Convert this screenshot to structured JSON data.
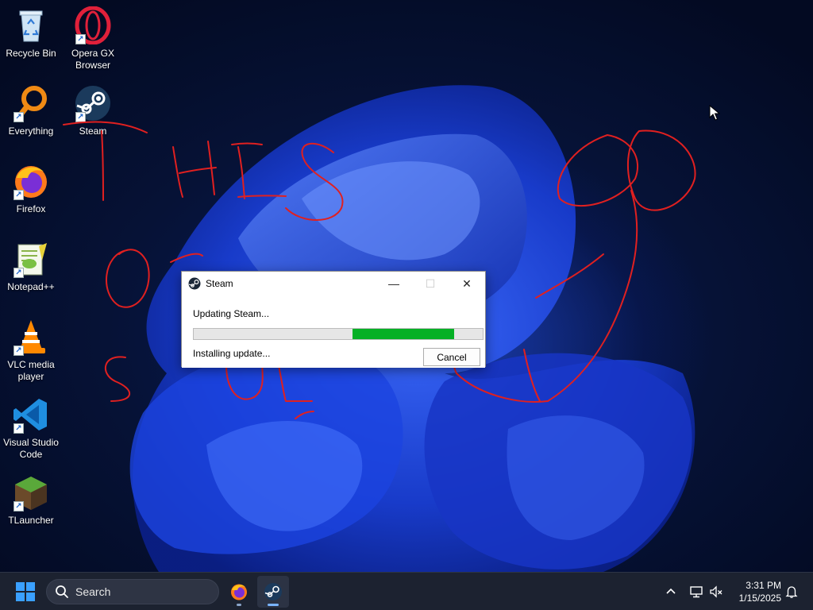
{
  "desktop": {
    "icons": [
      {
        "label": "Recycle Bin",
        "icon": "recycle-bin-icon"
      },
      {
        "label": "Opera GX Browser",
        "icon": "opera-gx-icon"
      },
      {
        "label": "Everything",
        "icon": "everything-search-icon"
      },
      {
        "label": "Steam",
        "icon": "steam-icon"
      },
      {
        "label": "Firefox",
        "icon": "firefox-icon"
      },
      {
        "label": "Notepad++",
        "icon": "notepad-plus-plus-icon"
      },
      {
        "label": "VLC media player",
        "icon": "vlc-icon"
      },
      {
        "label": "Visual Studio Code",
        "icon": "vscode-icon"
      },
      {
        "label": "TLauncher",
        "icon": "tlauncher-icon"
      }
    ],
    "scribble_color": "#e02020"
  },
  "dialog": {
    "title": "Steam",
    "status_main": "Updating Steam...",
    "status_sub": "Installing update...",
    "cancel_label": "Cancel",
    "progress_start": 0.55,
    "progress_end": 0.9,
    "progress_color": "#06b025",
    "minimize_glyph": "—",
    "maximize_glyph": "☐",
    "close_glyph": "✕"
  },
  "taskbar": {
    "search_placeholder": "Search",
    "apps": [
      "firefox-icon",
      "steam-icon"
    ],
    "active_app": "steam-icon",
    "tray": [
      "chevron-up-icon",
      "network-icon",
      "volume-muted-icon",
      "notification-bell-icon"
    ],
    "time": "3:31 PM",
    "date": "1/15/2025"
  }
}
